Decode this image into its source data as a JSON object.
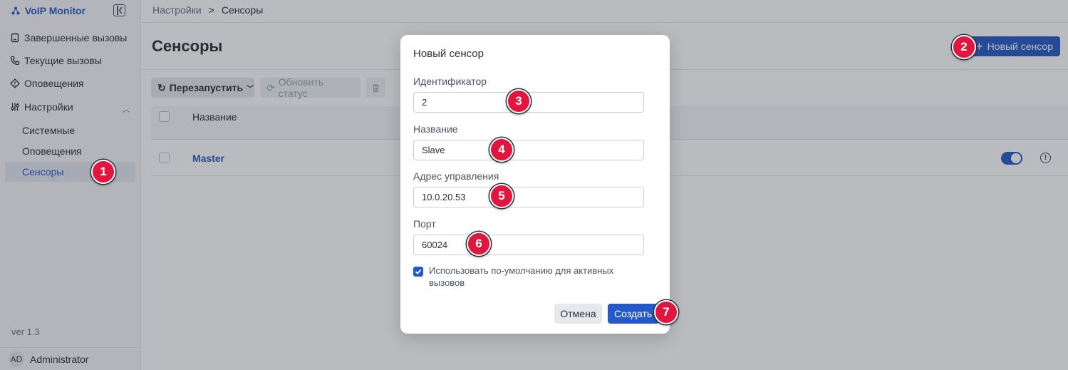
{
  "app": {
    "title": "VoIP Monitor",
    "version": "ver 1.3"
  },
  "sidebar": {
    "items": [
      {
        "label": "Завершенные вызовы",
        "icon": "document-icon"
      },
      {
        "label": "Текущие вызовы",
        "icon": "phone-icon"
      },
      {
        "label": "Оповещения",
        "icon": "alert-icon"
      },
      {
        "label": "Настройки",
        "icon": "sliders-icon"
      }
    ],
    "settings_sub": [
      {
        "label": "Системные"
      },
      {
        "label": "Оповещения"
      },
      {
        "label": "Сенсоры",
        "active": true
      }
    ],
    "user": {
      "initials": "AD",
      "name": "Administrator"
    }
  },
  "breadcrumb": {
    "parent": "Настройки",
    "separator": ">",
    "current": "Сенсоры"
  },
  "page": {
    "title": "Сенсоры",
    "new_button": "Новый сенсор",
    "toolbar": {
      "restart": "Перезапустить",
      "refresh": "Обновить статус"
    },
    "table": {
      "columns": [
        "Название"
      ],
      "rows": [
        {
          "name": "Master",
          "enabled": true
        }
      ]
    }
  },
  "modal": {
    "title": "Новый сенсор",
    "fields": {
      "id": {
        "label": "Идентификатор",
        "value": "2"
      },
      "name": {
        "label": "Название",
        "value": "Slave"
      },
      "address": {
        "label": "Адрес управления",
        "value": "10.0.20.53"
      },
      "port": {
        "label": "Порт",
        "value": "60024"
      }
    },
    "default_checkbox": {
      "label": "Использовать по-умолчанию для активных вызовов",
      "checked": true
    },
    "cancel": "Отмена",
    "create": "Создать"
  },
  "markers": [
    "1",
    "2",
    "3",
    "4",
    "5",
    "6",
    "7"
  ],
  "colors": {
    "accent": "#2459c7",
    "marker": "#e0163f",
    "overlay": "rgba(40,44,52,0.32)"
  }
}
